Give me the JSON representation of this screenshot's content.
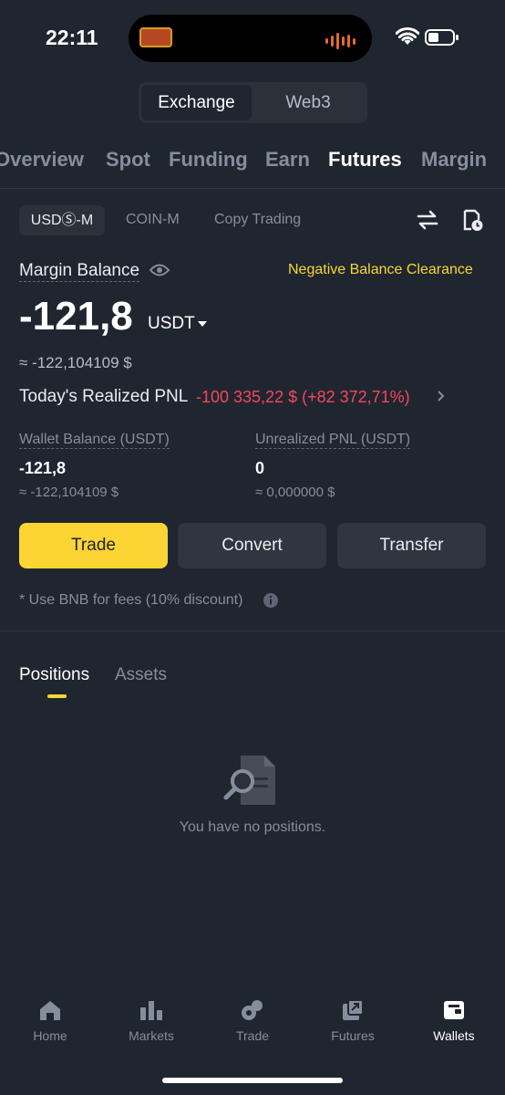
{
  "status_bar": {
    "time": "22:11"
  },
  "segment": {
    "exchange": "Exchange",
    "web3": "Web3"
  },
  "main_tabs": [
    "Overview",
    "Spot",
    "Funding",
    "Earn",
    "Futures",
    "Margin"
  ],
  "sub_tabs": {
    "usds_m": "USDⓈ-M",
    "coin_m": "COIN-M",
    "copy_trading": "Copy Trading"
  },
  "balance": {
    "margin_label": "Margin Balance",
    "negative_clearance": "Negative Balance Clearance",
    "value": "-121,8",
    "currency": "USDT",
    "approx_usd": "≈ -122,104109 $",
    "realized_label": "Today's Realized PNL",
    "realized_value": "-100 335,22 $ (+82 372,71%)"
  },
  "stats": {
    "wallet_label": "Wallet Balance (USDT)",
    "wallet_value": "-121,8",
    "wallet_usd": "≈ -122,104109 $",
    "unrealized_label": "Unrealized PNL (USDT)",
    "unrealized_value": "0",
    "unrealized_usd": "≈ 0,000000 $"
  },
  "actions": {
    "trade": "Trade",
    "convert": "Convert",
    "transfer": "Transfer"
  },
  "bnb_note": "*  Use BNB for fees (10% discount)",
  "positions_tabs": {
    "positions": "Positions",
    "assets": "Assets"
  },
  "empty_state": "You have no positions.",
  "bottom_nav": {
    "home": "Home",
    "markets": "Markets",
    "trade": "Trade",
    "futures": "Futures",
    "wallets": "Wallets"
  },
  "colors": {
    "accent": "#fcd535",
    "negative": "#f6465d",
    "background": "#1f2630"
  }
}
